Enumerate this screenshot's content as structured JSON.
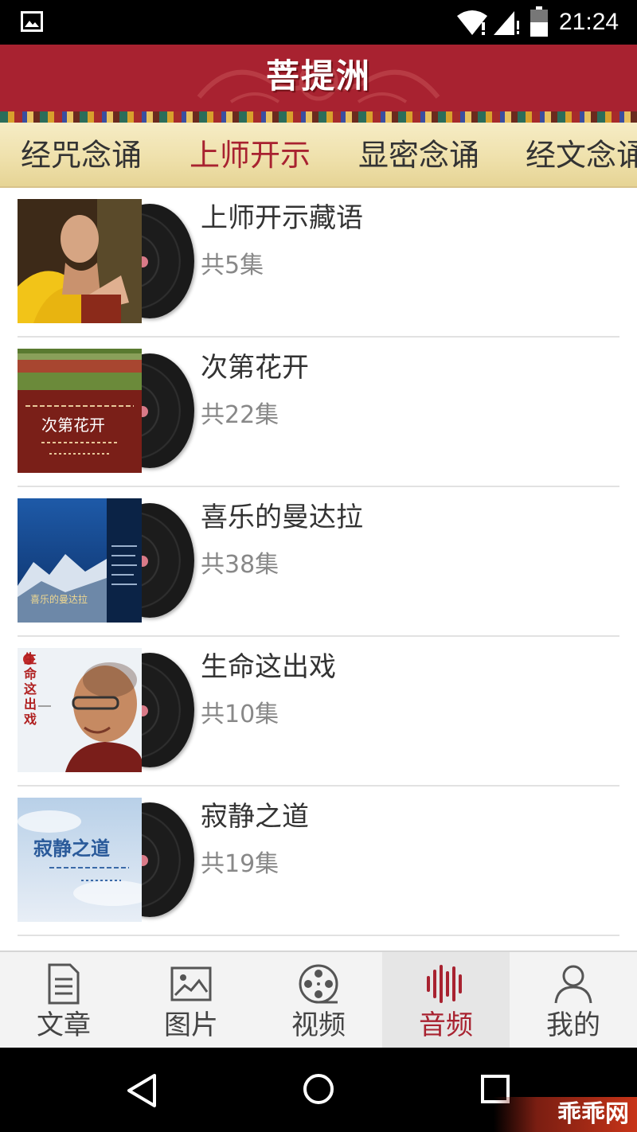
{
  "status_bar": {
    "time": "21:24"
  },
  "header": {
    "title": "菩提洲"
  },
  "tabs": [
    {
      "label": "经咒念诵"
    },
    {
      "label": "上师开示"
    },
    {
      "label": "显密念诵"
    },
    {
      "label": "经文念诵"
    }
  ],
  "active_tab": "上师开示",
  "albums": [
    {
      "title": "上师开示藏语",
      "count": "共5集"
    },
    {
      "title": "次第花开",
      "count": "共22集",
      "cover_text": "次第花开"
    },
    {
      "title": "喜乐的曼达拉",
      "count": "共38集",
      "cover_text": "喜乐的曼达拉"
    },
    {
      "title": "生命这出戏",
      "count": "共10集",
      "cover_text": "生命这出戏"
    },
    {
      "title": "寂静之道",
      "count": "共19集",
      "cover_text": "寂静之道"
    }
  ],
  "bottom_nav": [
    {
      "label": "文章",
      "icon": "document-icon"
    },
    {
      "label": "图片",
      "icon": "image-icon"
    },
    {
      "label": "视频",
      "icon": "film-reel-icon"
    },
    {
      "label": "音频",
      "icon": "audio-wave-icon"
    },
    {
      "label": "我的",
      "icon": "person-icon"
    }
  ],
  "active_nav": "音频",
  "watermark": "乖乖网",
  "colors": {
    "brand_red": "#a82230",
    "tab_bar": "#efe1ac",
    "nav_bg": "#f3f3f3"
  }
}
